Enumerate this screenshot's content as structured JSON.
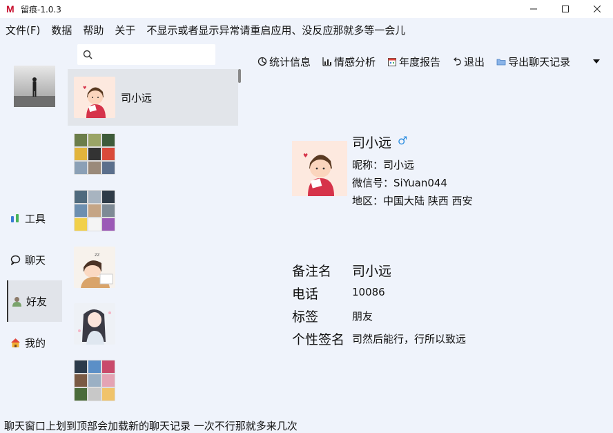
{
  "window": {
    "title": "留痕-1.0.3",
    "logo": "M"
  },
  "menu": {
    "items": [
      "文件(F)",
      "数据",
      "帮助",
      "关于"
    ],
    "note": "不显示或者显示异常请重启应用、没反应那就多等一会儿"
  },
  "search": {
    "placeholder": ""
  },
  "nav": {
    "items": [
      {
        "label": "工具",
        "icon": "tools-icon"
      },
      {
        "label": "聊天",
        "icon": "chat-icon"
      },
      {
        "label": "好友",
        "icon": "friends-icon"
      },
      {
        "label": "我的",
        "icon": "home-icon"
      }
    ],
    "active": "好友"
  },
  "contacts": [
    {
      "name": "司小远",
      "avatar": "cartoon-boy",
      "selected": true
    },
    {
      "name": "",
      "avatar": "group-grid"
    },
    {
      "name": "",
      "avatar": "group-grid"
    },
    {
      "name": "",
      "avatar": "sleeping-boy"
    },
    {
      "name": "",
      "avatar": "anime-girl"
    },
    {
      "name": "",
      "avatar": "group-grid"
    }
  ],
  "toolbar": {
    "items": [
      {
        "label": "统计信息",
        "icon": "pie-chart-icon"
      },
      {
        "label": "情感分析",
        "icon": "bar-chart-icon"
      },
      {
        "label": "年度报告",
        "icon": "calendar-icon"
      },
      {
        "label": "退出",
        "icon": "undo-icon"
      },
      {
        "label": "导出聊天记录",
        "icon": "folder-icon"
      }
    ]
  },
  "profile": {
    "name": "司小远",
    "gender_symbol": "♂",
    "nickname": "昵称：司小远",
    "wechat_id": "微信号：SiYuan044",
    "region": "地区：中国大陆 陕西 西安"
  },
  "details": [
    {
      "label": "备注名",
      "value": "司小远"
    },
    {
      "label": "电话",
      "value": "10086"
    },
    {
      "label": "标签",
      "value": "朋友"
    },
    {
      "label": "个性签名",
      "value": "司然后能行，行所以致远"
    }
  ],
  "status": "聊天窗口上划到顶部会加载新的聊天记录 一次不行那就多来几次",
  "colors": {
    "background": "#eff3fb",
    "selected": "#e2e5ea",
    "gender": "#2b8de0",
    "logo": "#c8102e"
  }
}
